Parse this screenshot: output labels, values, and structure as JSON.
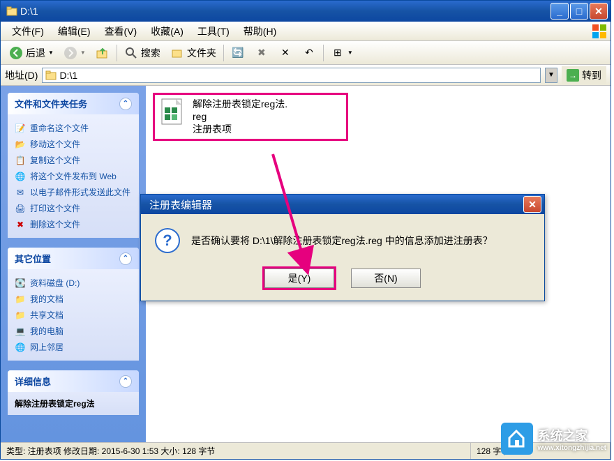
{
  "window": {
    "title": "D:\\1"
  },
  "menubar": {
    "file": "文件(F)",
    "edit": "编辑(E)",
    "view": "查看(V)",
    "favorites": "收藏(A)",
    "tools": "工具(T)",
    "help": "帮助(H)"
  },
  "toolbar": {
    "back": "后退",
    "search": "搜索",
    "folders": "文件夹"
  },
  "addressbar": {
    "label": "地址(D)",
    "value": "D:\\1",
    "go": "转到"
  },
  "sidebar": {
    "tasks": {
      "header": "文件和文件夹任务",
      "items": [
        "重命名这个文件",
        "移动这个文件",
        "复制这个文件",
        "将这个文件发布到 Web",
        "以电子邮件形式发送此文件",
        "打印这个文件",
        "删除这个文件"
      ]
    },
    "places": {
      "header": "其它位置",
      "items": [
        "资料磁盘 (D:)",
        "我的文档",
        "共享文档",
        "我的电脑",
        "网上邻居"
      ]
    },
    "details": {
      "header": "详细信息",
      "filename": "解除注册表锁定reg法"
    }
  },
  "main": {
    "file": {
      "name_line1": "解除注册表锁定reg法.",
      "name_line2": "reg",
      "type": "注册表项"
    }
  },
  "dialog": {
    "title": "注册表编辑器",
    "message": "是否确认要将 D:\\1\\解除注册表锁定reg法.reg 中的信息添加进注册表？",
    "yes": "是(Y)",
    "no": "否(N)"
  },
  "statusbar": {
    "left": "类型: 注册表项 修改日期: 2015-6-30 1:53 大小: 128 字节",
    "right": "128 字节"
  },
  "watermark": {
    "name": "系统之家",
    "url": "www.xitongzhijia.net"
  }
}
